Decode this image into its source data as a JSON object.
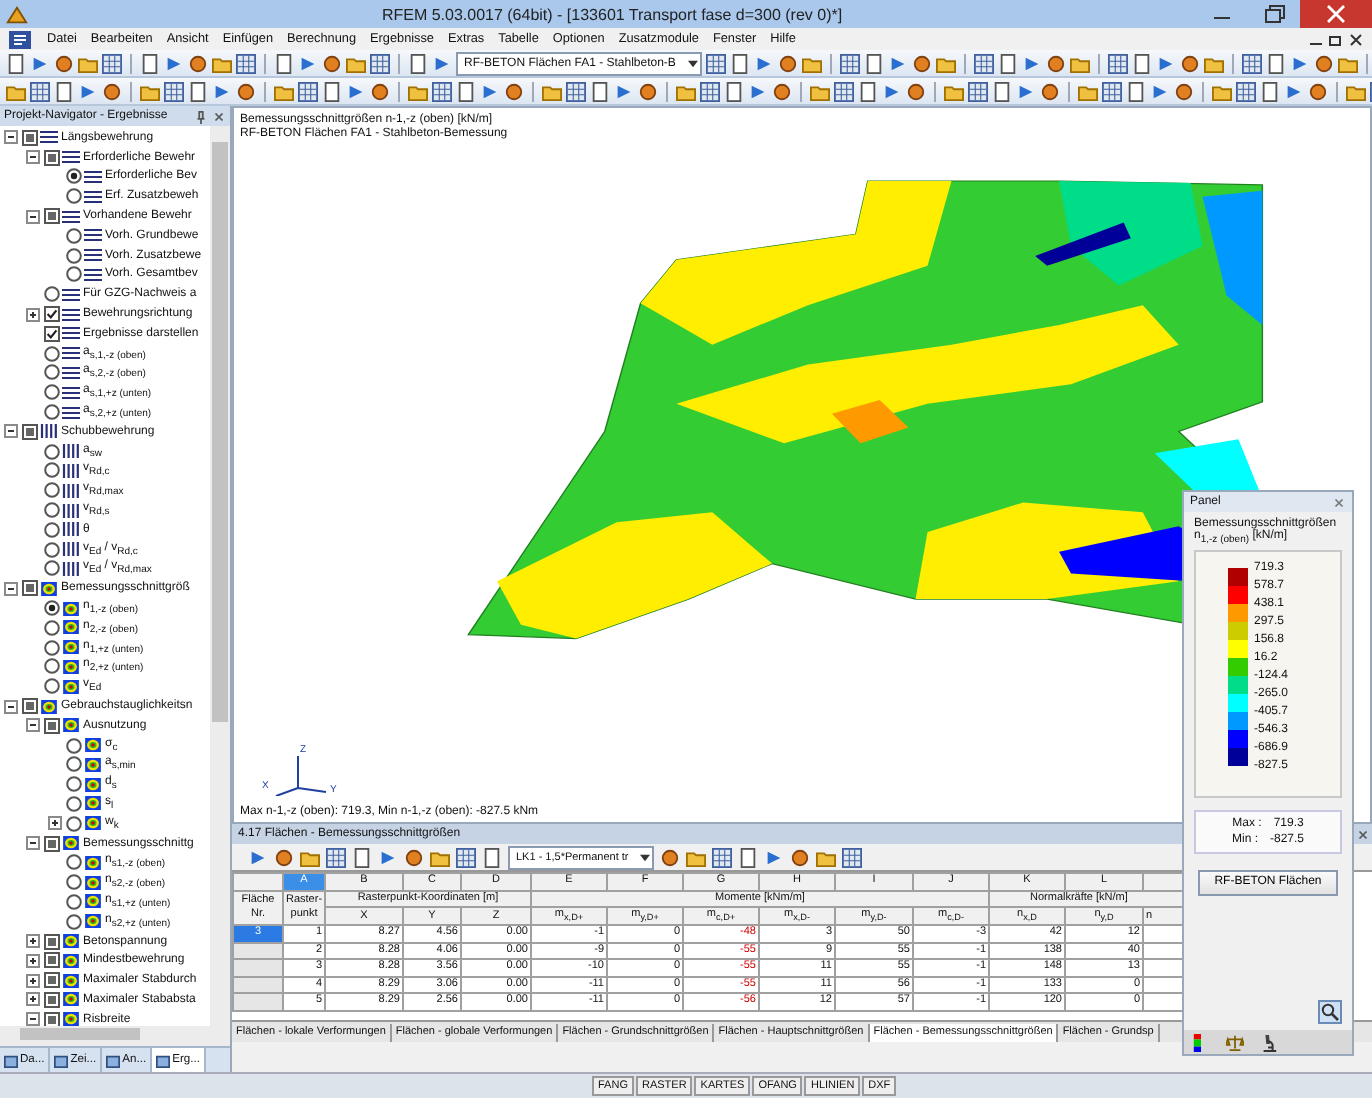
{
  "window": {
    "title": "RFEM 5.03.0017 (64bit) - [133601 Transport fase d=300 (rev 0)*]"
  },
  "menu": [
    "Datei",
    "Bearbeiten",
    "Ansicht",
    "Einfügen",
    "Berechnung",
    "Ergebnisse",
    "Extras",
    "Tabelle",
    "Optionen",
    "Zusatzmodule",
    "Fenster",
    "Hilfe"
  ],
  "toolbar": {
    "module_select": "RF-BETON Flächen FA1 - Stahlbeton-B"
  },
  "navigator": {
    "title": "Projekt-Navigator - Ergebnisse",
    "tree": [
      {
        "label": "Längsbewehrung",
        "kind": "group",
        "partial": true,
        "expanded": true,
        "children": [
          {
            "label": "Erforderliche Bewehr",
            "kind": "group",
            "partial": true,
            "expanded": true,
            "children": [
              {
                "label": "Erforderliche Bev",
                "kind": "radio",
                "selected": true
              },
              {
                "label": "Erf. Zusatzbeweh",
                "kind": "radio",
                "selected": false
              }
            ]
          },
          {
            "label": "Vorhandene Bewehr",
            "kind": "group",
            "partial": true,
            "expanded": true,
            "children": [
              {
                "label": "Vorh. Grundbewe",
                "kind": "radio",
                "selected": false
              },
              {
                "label": "Vorh. Zusatzbewe",
                "kind": "radio",
                "selected": false
              },
              {
                "label": "Vorh. Gesamtbev",
                "kind": "radio",
                "selected": false
              }
            ]
          },
          {
            "label": "Für GZG-Nachweis a",
            "kind": "radio",
            "selected": false
          },
          {
            "label": "Bewehrungsrichtung",
            "kind": "check",
            "checked": true,
            "expanded": false
          },
          {
            "label": "Ergebnisse darstellen",
            "kind": "check",
            "checked": true
          },
          {
            "label": "a$_{s,1,-z (oben)}$",
            "kind": "radio",
            "selected": false
          },
          {
            "label": "a$_{s,2,-z (oben)}$",
            "kind": "radio",
            "selected": false
          },
          {
            "label": "a$_{s,1,+z (unten)}$",
            "kind": "radio",
            "selected": false
          },
          {
            "label": "a$_{s,2,+z (unten)}$",
            "kind": "radio",
            "selected": false
          }
        ]
      },
      {
        "label": "Schubbewehrung",
        "kind": "group",
        "partial": true,
        "expanded": true,
        "children": [
          {
            "label": "a$_{sw}$",
            "kind": "radio",
            "selected": false
          },
          {
            "label": "v$_{Rd,c}$",
            "kind": "radio",
            "selected": false
          },
          {
            "label": "v$_{Rd,max}$",
            "kind": "radio",
            "selected": false
          },
          {
            "label": "v$_{Rd,s}$",
            "kind": "radio",
            "selected": false
          },
          {
            "label": "θ",
            "kind": "radio",
            "selected": false
          },
          {
            "label": "v$_{Ed}$ / v$_{Rd,c}$",
            "kind": "radio",
            "selected": false
          },
          {
            "label": "v$_{Ed}$ / v$_{Rd,max}$",
            "kind": "radio",
            "selected": false
          }
        ]
      },
      {
        "label": "Bemessungsschnittgröß",
        "kind": "group",
        "partial": true,
        "expanded": true,
        "children": [
          {
            "label": "n$_{1,-z (oben)}$",
            "kind": "radio",
            "selected": true
          },
          {
            "label": "n$_{2,-z (oben)}$",
            "kind": "radio",
            "selected": false
          },
          {
            "label": "n$_{1,+z (unten)}$",
            "kind": "radio",
            "selected": false
          },
          {
            "label": "n$_{2,+z (unten)}$",
            "kind": "radio",
            "selected": false
          },
          {
            "label": "v$_{Ed}$",
            "kind": "radio",
            "selected": false
          }
        ]
      },
      {
        "label": "Gebrauchstauglichkeitsn",
        "kind": "group",
        "partial": true,
        "expanded": true,
        "children": [
          {
            "label": "Ausnutzung",
            "kind": "group",
            "partial": true,
            "expanded": true,
            "children": [
              {
                "label": "σ$_{c}$",
                "kind": "radio",
                "selected": false
              },
              {
                "label": "a$_{s,min}$",
                "kind": "radio",
                "selected": false
              },
              {
                "label": "d$_{s}$",
                "kind": "radio",
                "selected": false
              },
              {
                "label": "s$_{l}$",
                "kind": "radio",
                "selected": false
              },
              {
                "label": "w$_{k}$",
                "kind": "radio",
                "selected": false,
                "expanded": false
              }
            ]
          },
          {
            "label": "Bemessungsschnittg",
            "kind": "group",
            "partial": true,
            "expanded": true,
            "children": [
              {
                "label": "n$_{s1,-z (oben)}$",
                "kind": "radio",
                "selected": false
              },
              {
                "label": "n$_{s2,-z (oben)}$",
                "kind": "radio",
                "selected": false
              },
              {
                "label": "n$_{s1,+z (unten)}$",
                "kind": "radio",
                "selected": false
              },
              {
                "label": "n$_{s2,+z (unten)}$",
                "kind": "radio",
                "selected": false
              }
            ]
          },
          {
            "label": "Betonspannung",
            "kind": "group",
            "partial": true,
            "expanded": false
          },
          {
            "label": "Mindestbewehrung",
            "kind": "group",
            "partial": true,
            "expanded": false
          },
          {
            "label": "Maximaler Stabdurch",
            "kind": "group",
            "partial": true,
            "expanded": false
          },
          {
            "label": "Maximaler Stababsta",
            "kind": "group",
            "partial": true,
            "expanded": false
          },
          {
            "label": "Risbreite",
            "kind": "group",
            "partial": true,
            "expanded": true
          }
        ]
      }
    ],
    "tabs": [
      {
        "label": "Da...",
        "selected": false
      },
      {
        "label": "Zei...",
        "selected": false
      },
      {
        "label": "An...",
        "selected": false
      },
      {
        "label": "Erg...",
        "selected": true
      }
    ]
  },
  "viewport": {
    "header": [
      "Bemessungsschnittgrößen n-1,-z (oben) [kN/m]",
      "RF-BETON Flächen FA1 - Stahlbeton-Bemessung"
    ],
    "axes": [
      "X",
      "Y",
      "Z"
    ],
    "footer": "Max n-1,-z (oben): 719.3, Min n-1,-z (oben): -827.5 kNm"
  },
  "table": {
    "title": "4.17 Flächen - Bemessungsschnittgrößen",
    "load_case": "LK1 - 1,5*Permanent tr",
    "column_letters": [
      {
        "label": "A",
        "selected": true
      },
      {
        "label": "B",
        "selected": false
      },
      {
        "label": "C",
        "selected": false
      },
      {
        "label": "D",
        "selected": false
      },
      {
        "label": "E",
        "selected": false
      },
      {
        "label": "F",
        "selected": false
      },
      {
        "label": "G",
        "selected": false
      },
      {
        "label": "H",
        "selected": false
      },
      {
        "label": "I",
        "selected": false
      },
      {
        "label": "J",
        "selected": false
      },
      {
        "label": "K",
        "selected": false
      },
      {
        "label": "L",
        "selected": false
      }
    ],
    "groups": [
      "Rasterpunkt-Koordinaten [m]",
      "Momente [kNm/m]",
      "Normalkräfte [kN/m]"
    ],
    "columns": [
      {
        "label": "Fläche Nr."
      },
      {
        "label": "Raster-punkt"
      },
      {
        "label": "X"
      },
      {
        "label": "Y"
      },
      {
        "label": "Z"
      },
      {
        "label": "m$_{x,D+}$"
      },
      {
        "label": "m$_{y,D+}$"
      },
      {
        "label": "m$_{c,D+}$",
        "highlight": true
      },
      {
        "label": "m$_{x,D-}$"
      },
      {
        "label": "m$_{y,D-}$"
      },
      {
        "label": "m$_{c,D-}$"
      },
      {
        "label": "n$_{x,D}$"
      },
      {
        "label": "n$_{y,D}$"
      },
      {
        "label": "n"
      }
    ],
    "rows": [
      {
        "selected": true,
        "cells": [
          "3",
          "1",
          "8.27",
          "4.56",
          "0.00",
          "-1",
          "0",
          "-48",
          "3",
          "50",
          "-3",
          "42",
          "12"
        ]
      },
      {
        "selected": false,
        "cells": [
          "",
          "2",
          "8.28",
          "4.06",
          "0.00",
          "-9",
          "0",
          "-55",
          "9",
          "55",
          "-1",
          "138",
          "40"
        ]
      },
      {
        "selected": false,
        "cells": [
          "",
          "3",
          "8.28",
          "3.56",
          "0.00",
          "-10",
          "0",
          "-55",
          "11",
          "55",
          "-1",
          "148",
          "13"
        ]
      },
      {
        "selected": false,
        "cells": [
          "",
          "4",
          "8.29",
          "3.06",
          "0.00",
          "-11",
          "0",
          "-55",
          "11",
          "56",
          "-1",
          "133",
          "0"
        ]
      },
      {
        "selected": false,
        "cells": [
          "",
          "5",
          "8.29",
          "2.56",
          "0.00",
          "-11",
          "0",
          "-56",
          "12",
          "57",
          "-1",
          "120",
          "0"
        ]
      }
    ],
    "sheets": [
      {
        "label": "Flächen - lokale Verformungen",
        "selected": false
      },
      {
        "label": "Flächen - globale Verformungen",
        "selected": false
      },
      {
        "label": "Flächen - Grundschnittgrößen",
        "selected": false
      },
      {
        "label": "Flächen - Hauptschnittgrößen",
        "selected": false
      },
      {
        "label": "Flächen - Bemessungsschnittgrößen",
        "selected": true
      },
      {
        "label": "Flächen - Grundsp",
        "selected": false
      }
    ]
  },
  "panel": {
    "title": "Panel",
    "heading": "Bemessungsschnittgrößen",
    "unit_label": "n$_{1,-z (oben)}$ [kN/m]",
    "bands": [
      {
        "color": "#b00000"
      },
      {
        "color": "#ff0000"
      },
      {
        "color": "#ff9900"
      },
      {
        "color": "#cccc00"
      },
      {
        "color": "#ffff00"
      },
      {
        "color": "#33cc00"
      },
      {
        "color": "#00dd88"
      },
      {
        "color": "#00ffff"
      },
      {
        "color": "#0099ff"
      },
      {
        "color": "#0000ff"
      },
      {
        "color": "#000099"
      }
    ],
    "ticks": [
      "719.3",
      "578.7",
      "438.1",
      "297.5",
      "156.8",
      "16.2",
      "-124.4",
      "-265.0",
      "-405.7",
      "-546.3",
      "-686.9",
      "-827.5"
    ],
    "max_label": "Max :",
    "max": "719.3",
    "min_label": "Min :",
    "min": "-827.5",
    "button": "RF-BETON Flächen"
  },
  "status_bar": {
    "toggles": [
      "FANG",
      "RASTER",
      "KARTES",
      "OFANG",
      "HLINIEN",
      "DXF"
    ]
  }
}
